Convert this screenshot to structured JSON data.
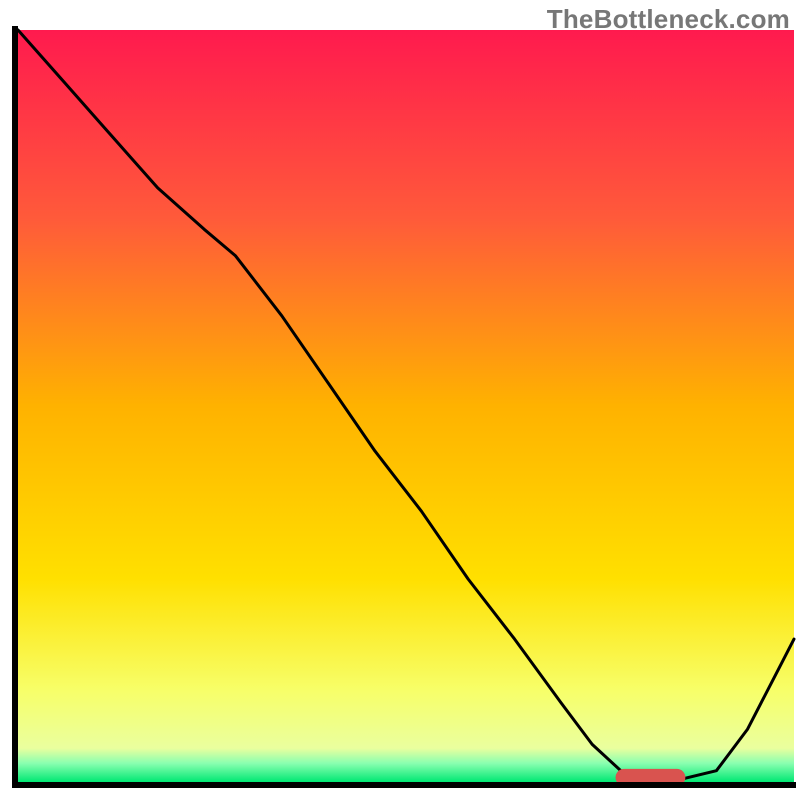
{
  "watermark": "TheBottleneck.com",
  "chart_data": {
    "type": "line",
    "title": "",
    "xlabel": "",
    "ylabel": "",
    "xlim": [
      0,
      100
    ],
    "ylim": [
      0,
      100
    ],
    "axes_visible": false,
    "background_gradient_stops": [
      {
        "offset": 0.0,
        "color": "#ff1a4e"
      },
      {
        "offset": 0.25,
        "color": "#ff5a3a"
      },
      {
        "offset": 0.5,
        "color": "#ffb200"
      },
      {
        "offset": 0.73,
        "color": "#ffe000"
      },
      {
        "offset": 0.88,
        "color": "#f7ff6a"
      },
      {
        "offset": 0.955,
        "color": "#eaff9e"
      },
      {
        "offset": 0.975,
        "color": "#8affb0"
      },
      {
        "offset": 1.0,
        "color": "#00e873"
      }
    ],
    "series": [
      {
        "name": "bottleneck-curve",
        "color": "#000000",
        "stroke_width": 3,
        "x": [
          0,
          6,
          12,
          18,
          24,
          28,
          34,
          40,
          46,
          52,
          58,
          64,
          70,
          74,
          78,
          82,
          86,
          90,
          94,
          98,
          100
        ],
        "y": [
          100,
          93,
          86,
          79,
          73.5,
          70,
          62,
          53,
          44,
          36,
          27,
          19,
          10.5,
          5,
          1.2,
          0.5,
          0.5,
          1.5,
          7,
          15,
          19
        ]
      }
    ],
    "marker": {
      "name": "target-range",
      "color": "#d9534f",
      "x_start": 77,
      "x_end": 86,
      "y": 0.6,
      "thickness": 2.3
    },
    "frame": {
      "color": "#000000",
      "stroke_width": 6
    }
  }
}
